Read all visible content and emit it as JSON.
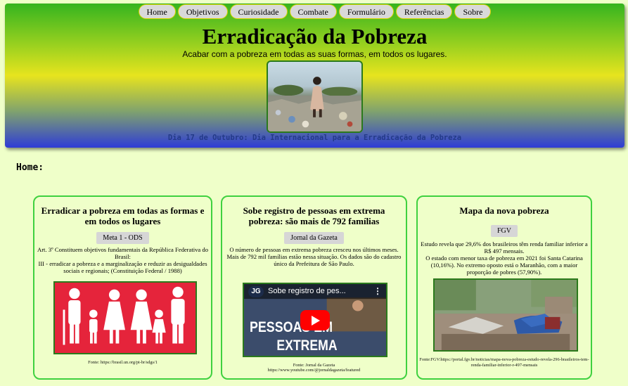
{
  "nav": {
    "items": [
      "Home",
      "Objetivos",
      "Curiosidade",
      "Combate",
      "Formulário",
      "Referências",
      "Sobre"
    ]
  },
  "header": {
    "title": "Erradicação da Pobreza",
    "subtitle": "Acabar com a pobreza em todas as suas formas, em todos os lugares.",
    "caption": "Dia 17 de Outubro: Dia Internacional para a Erradicação da Pobreza"
  },
  "section": {
    "title": "Home:"
  },
  "cards": [
    {
      "title": "Erradicar a pobreza em todas as formas e em todos os lugares",
      "badge": "Meta 1 - ODS",
      "text": "Art. 3º Constituem objetivos fundamentais da República Federativa do Brasil:",
      "text2": "III - erradicar a pobreza e a marginalização e reduzir as desigualdades sociais e regionais; (Constituição Federal / 1988)",
      "source": "Fonte: https://brasil.un.org/pt-br/sdgs/1"
    },
    {
      "title": "Sobe registro de pessoas em extrema pobreza: são mais de 792 famílias",
      "badge": "Jornal da Gazeta",
      "text": "O número de pessoas em extrema pobreza cresceu nos últimos meses. Mais de 792 mil famílias estão nessa situação. Os dados são do cadastro único da Prefeitura de São Paulo.",
      "video_channel": "JG",
      "video_title": "Sobe registro de pes...",
      "video_overlay_1": "PESSOAS EM",
      "video_overlay_2": "EXTREMA POBREZA",
      "source": "Fonte: Jornal da Gazeta",
      "source2": "https://www.youtube.com/@jornaldagazeta/featured"
    },
    {
      "title": "Mapa da nova pobreza",
      "badge": "FGV",
      "text": "Estudo revela que 29,6% dos brasileiros têm renda familiar inferior a R$ 497 mensais.",
      "text2": "O estado com menor taxa de pobreza em 2021 foi Santa Catarina (10,16%). No extremo oposto está o Maranhão, com a maior proporção de pobres (57,90%).",
      "source": "Fonte:FGV:https://portal.fgv.br/noticias/mapa-nova-pobreza-estudo-revela-296-brasileiros-tem-renda-familiar-inferior-r-497-mensais"
    }
  ],
  "colors": {
    "background": "#efffc9",
    "card_border": "#3fd13f",
    "sdg_red": "#e5243b",
    "caption_blue": "#233a88"
  }
}
